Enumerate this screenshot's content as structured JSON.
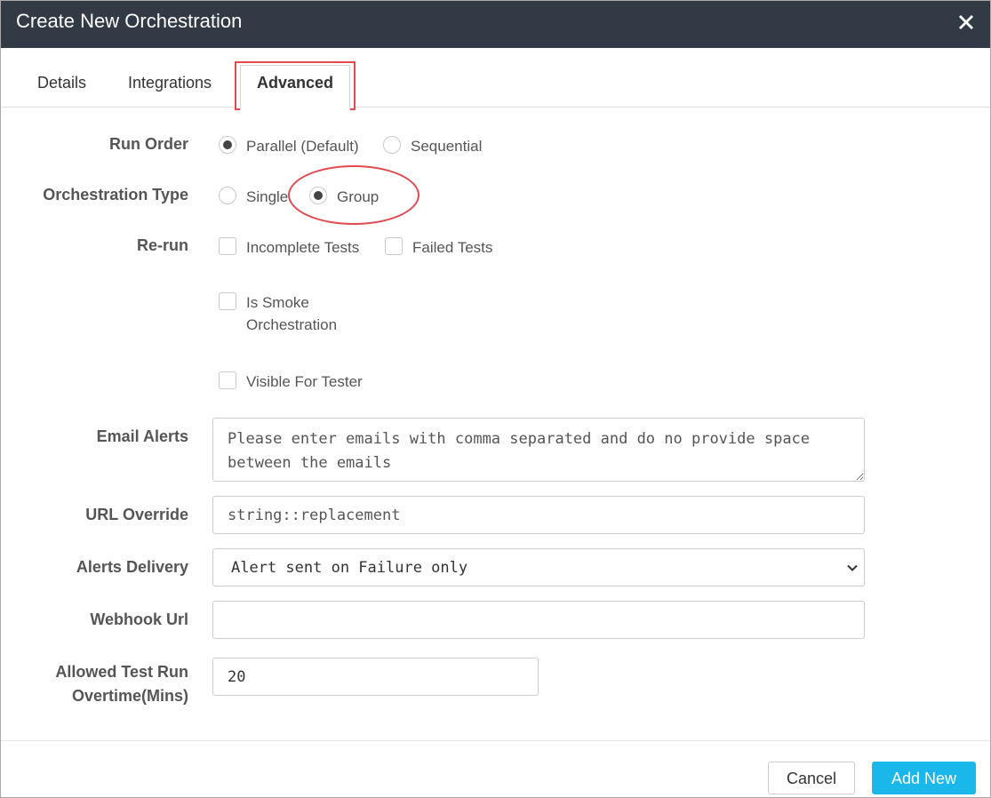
{
  "dialog": {
    "title": "Create New Orchestration"
  },
  "tabs": [
    {
      "label": "Details"
    },
    {
      "label": "Integrations"
    },
    {
      "label": "Advanced",
      "active": true
    }
  ],
  "run_order": {
    "label": "Run Order",
    "options": [
      {
        "label": "Parallel (Default)",
        "checked": true
      },
      {
        "label": "Sequential",
        "checked": false
      }
    ]
  },
  "orchestration_type": {
    "label": "Orchestration Type",
    "options": [
      {
        "label": "Single",
        "checked": false
      },
      {
        "label": "Group",
        "checked": true
      }
    ]
  },
  "rerun": {
    "label": "Re-run",
    "options": [
      {
        "label": "Incomplete Tests",
        "checked": false
      },
      {
        "label": "Failed Tests",
        "checked": false
      }
    ]
  },
  "smoke": {
    "line1": "Is Smoke",
    "line2": "Orchestration",
    "checked": false
  },
  "visible_for_tester": {
    "label": "Visible For Tester",
    "checked": false
  },
  "email_alerts": {
    "label": "Email Alerts",
    "placeholder": "Please enter emails with comma separated and do no provide space between the emails"
  },
  "url_override": {
    "label": "URL Override",
    "placeholder": "string::replacement"
  },
  "alerts_delivery": {
    "label": "Alerts Delivery",
    "selected": "Alert sent on Failure only"
  },
  "webhook_url": {
    "label": "Webhook Url",
    "value": ""
  },
  "overtime": {
    "label_line1": "Allowed Test Run",
    "label_line2": "Overtime(Mins)",
    "value": "20"
  },
  "footer": {
    "cancel_label": "Cancel",
    "submit_label": "Add New"
  },
  "colors": {
    "header_bg": "#313a45",
    "annotation_red": "#e24a4f",
    "primary_button": "#1ab7ea"
  },
  "icons": {
    "close": "close-x-icon",
    "select_arrow": "chevron-down-icon"
  }
}
